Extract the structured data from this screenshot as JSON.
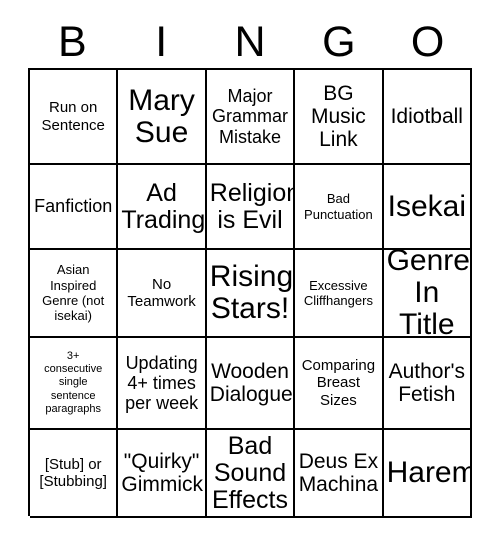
{
  "card": {
    "title": "BINGO",
    "headers": [
      "B",
      "I",
      "N",
      "G",
      "O"
    ],
    "colors": {
      "border": "#000000",
      "background": "#ffffff",
      "text": "#000000"
    },
    "rows": [
      [
        {
          "text": "Run on\nSentence",
          "size": "sm"
        },
        {
          "text": "Mary\nSue",
          "size": "xxl"
        },
        {
          "text": "Major\nGrammar\nMistake",
          "size": "md"
        },
        {
          "text": "BG\nMusic\nLink",
          "size": "lg"
        },
        {
          "text": "Idiotball",
          "size": "lg"
        }
      ],
      [
        {
          "text": "Fanfiction",
          "size": "md"
        },
        {
          "text": "Ad\nTrading",
          "size": "xl"
        },
        {
          "text": "Religion\nis Evil",
          "size": "xl"
        },
        {
          "text": "Bad\nPunctuation",
          "size": "xs"
        },
        {
          "text": "Isekai",
          "size": "xxl"
        }
      ],
      [
        {
          "text": "Asian\nInspired\nGenre (not\nisekai)",
          "size": "xs"
        },
        {
          "text": "No\nTeamwork",
          "size": "sm"
        },
        {
          "text": "Rising\nStars!",
          "size": "xxl"
        },
        {
          "text": "Excessive\nCliffhangers",
          "size": "xs"
        },
        {
          "text": "Genre\nIn Title",
          "size": "xxl"
        }
      ],
      [
        {
          "text": "3+\nconsecutive\nsingle\nsentence\nparagraphs",
          "size": "xxs"
        },
        {
          "text": "Updating\n4+ times\nper week",
          "size": "md"
        },
        {
          "text": "Wooden\nDialogue",
          "size": "lg"
        },
        {
          "text": "Comparing\nBreast\nSizes",
          "size": "sm"
        },
        {
          "text": "Author's\nFetish",
          "size": "lg"
        }
      ],
      [
        {
          "text": "[Stub] or\n[Stubbing]",
          "size": "sm"
        },
        {
          "text": "\"Quirky\"\nGimmick",
          "size": "lg"
        },
        {
          "text": "Bad\nSound\nEffects",
          "size": "xl"
        },
        {
          "text": "Deus Ex\nMachina",
          "size": "lg"
        },
        {
          "text": "Harem",
          "size": "xxl"
        }
      ]
    ]
  }
}
